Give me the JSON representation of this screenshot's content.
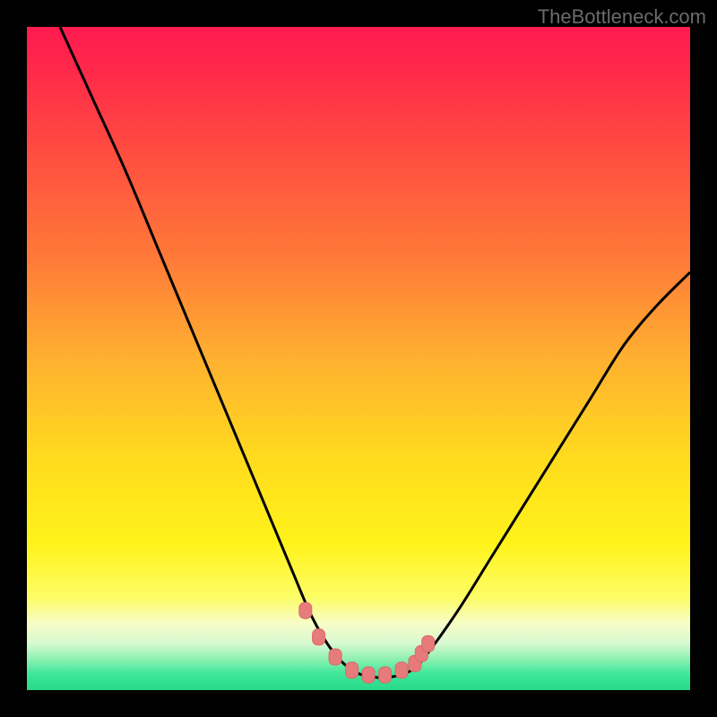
{
  "watermark": "TheBottleneck.com",
  "colors": {
    "frame": "#000000",
    "curve_stroke": "#000000",
    "marker_fill": "#e77b7b",
    "marker_stroke": "#d86a6a",
    "gradient_stops": [
      {
        "offset": 0.0,
        "color": "#ff1a4f"
      },
      {
        "offset": 0.07,
        "color": "#ff2a4a"
      },
      {
        "offset": 0.2,
        "color": "#ff5040"
      },
      {
        "offset": 0.35,
        "color": "#ff7a38"
      },
      {
        "offset": 0.5,
        "color": "#ffb030"
      },
      {
        "offset": 0.65,
        "color": "#ffdb1e"
      },
      {
        "offset": 0.78,
        "color": "#fff31a"
      },
      {
        "offset": 0.86,
        "color": "#fdfd66"
      },
      {
        "offset": 0.9,
        "color": "#f7fdc8"
      },
      {
        "offset": 0.93,
        "color": "#d7f9d0"
      },
      {
        "offset": 0.955,
        "color": "#88f0b0"
      },
      {
        "offset": 0.975,
        "color": "#3fe79a"
      },
      {
        "offset": 1.0,
        "color": "#27d989"
      }
    ]
  },
  "chart_data": {
    "type": "line",
    "title": "",
    "xlabel": "",
    "ylabel": "",
    "xlim": [
      0,
      100
    ],
    "ylim": [
      0,
      100
    ],
    "grid": false,
    "series": [
      {
        "name": "bottleneck-curve",
        "x": [
          5,
          10,
          15,
          20,
          25,
          30,
          35,
          40,
          43,
          46,
          49,
          52,
          55,
          58,
          60,
          65,
          70,
          75,
          80,
          85,
          90,
          95,
          100
        ],
        "y": [
          100,
          89,
          78,
          66,
          54,
          42,
          30,
          18,
          11,
          6,
          3,
          2,
          2,
          3,
          5,
          12,
          20,
          28,
          36,
          44,
          52,
          58,
          63
        ]
      }
    ],
    "markers": {
      "name": "highlighted-points",
      "x": [
        42.0,
        44.0,
        46.5,
        49.0,
        51.5,
        54.0,
        56.5,
        58.5,
        59.5,
        60.5
      ],
      "y": [
        12.0,
        8.0,
        5.0,
        3.0,
        2.3,
        2.3,
        3.0,
        4.0,
        5.5,
        7.0
      ]
    }
  }
}
